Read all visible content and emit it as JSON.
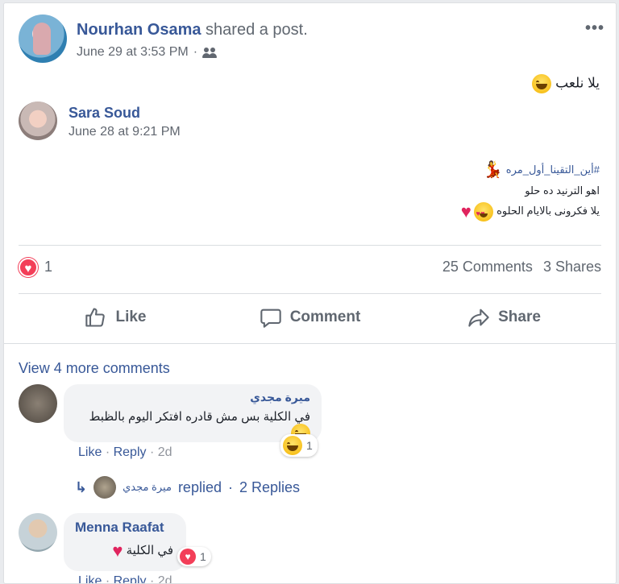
{
  "post": {
    "author": "Nourhan Osama",
    "action": "shared a post.",
    "timestamp": "June 29 at 3:53 PM",
    "separator": "·",
    "privacy_icon": "friends-icon",
    "more_icon": "•••",
    "text": "يلا نلعب"
  },
  "shared_post": {
    "author": "Sara Soud",
    "timestamp": "June 28 at 9:21 PM",
    "hashtag": "#أين_التقينا_أول_مره",
    "line2": "اهو الترنيد ده حلو",
    "line3": "يلا فكرونى بالايام الحلوه"
  },
  "stats": {
    "reaction_count": "1",
    "comments": "25 Comments",
    "shares": "3 Shares",
    "heart_glyph": "♥"
  },
  "actions": {
    "like": "Like",
    "comment": "Comment",
    "share": "Share"
  },
  "comments_section": {
    "view_more": "View 4 more comments",
    "comments": [
      {
        "author": "ميرة مجدي",
        "text": "في الكلية بس مش قادره افتكر اليوم بالظبط",
        "reaction_count": "1",
        "like": "Like",
        "reply": "Reply",
        "date": "2d",
        "sep": "·",
        "replied_name": "ميرة مجدي",
        "replied": "replied",
        "replies": "2 Replies"
      },
      {
        "author": "Menna Raafat",
        "text": "في الكلية",
        "reaction_count": "1",
        "like": "Like",
        "reply": "Reply",
        "date": "2d",
        "sep": "·"
      }
    ]
  },
  "colors": {
    "link": "#385898",
    "muted": "#606770",
    "heart": "#f33e58"
  }
}
